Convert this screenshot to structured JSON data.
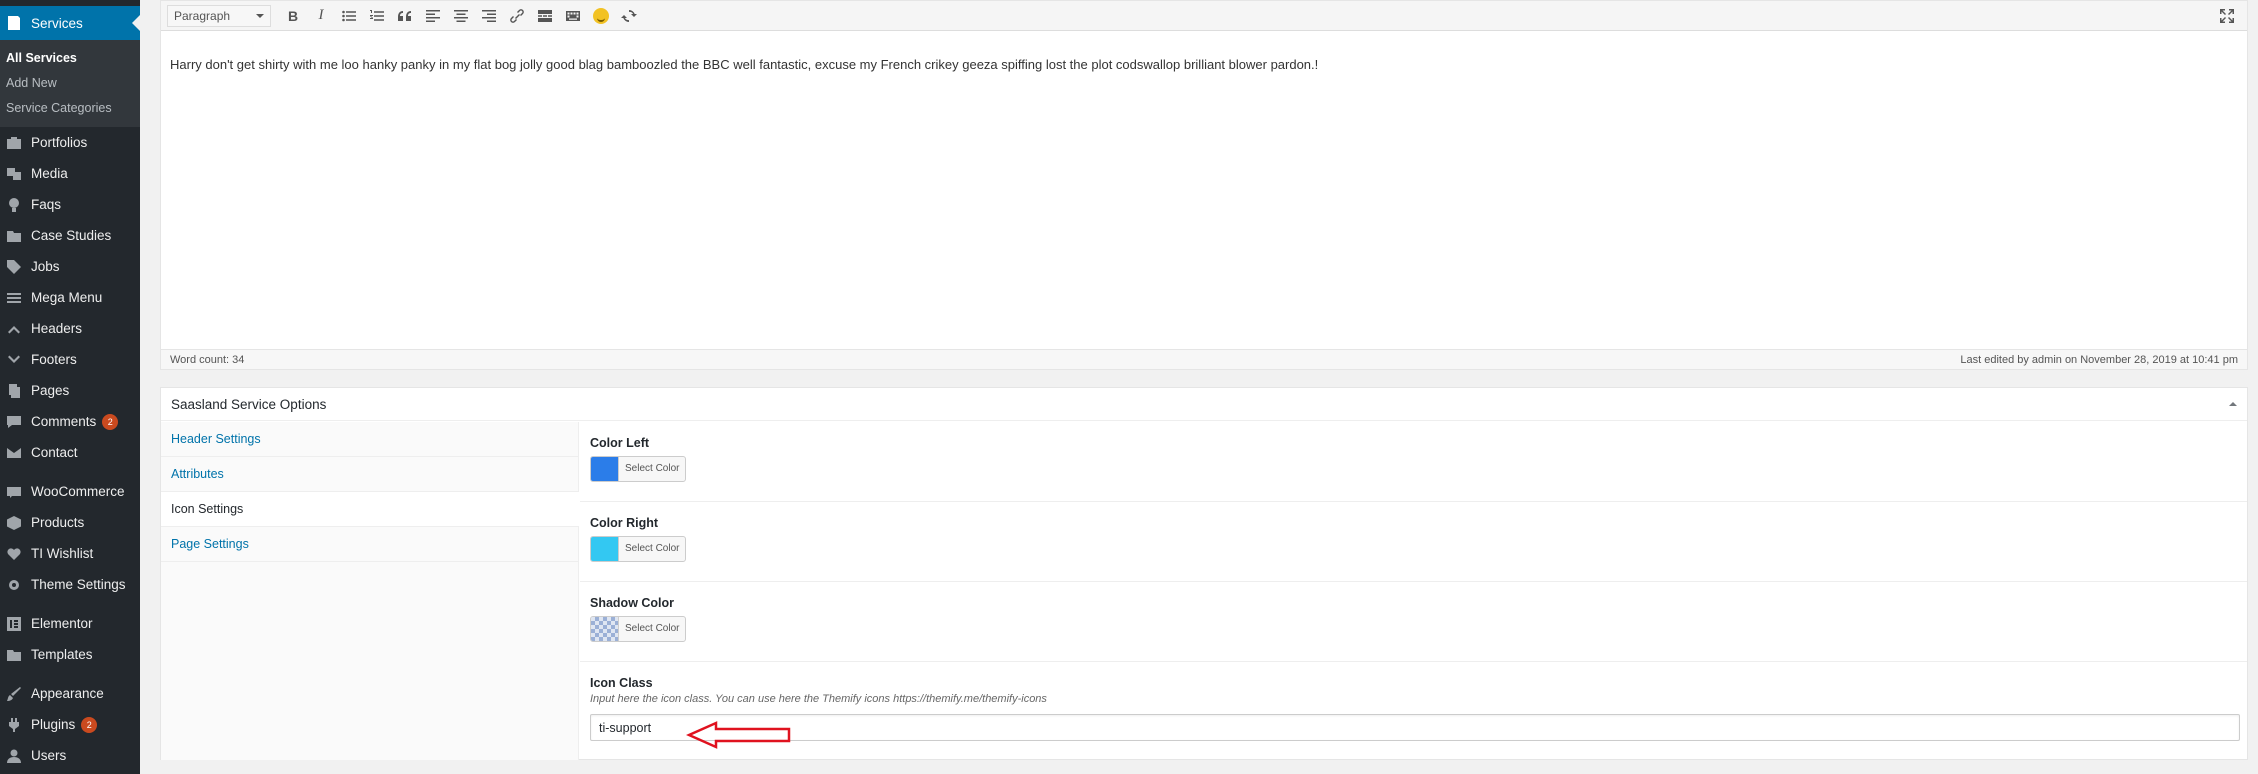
{
  "sidebar": {
    "current": {
      "label": "Services",
      "icon": "services-icon"
    },
    "submenu": [
      "All Services",
      "Add New",
      "Service Categories"
    ],
    "items": [
      {
        "label": "Portfolios",
        "icon": "portfolio-icon"
      },
      {
        "label": "Media",
        "icon": "media-icon"
      },
      {
        "label": "Faqs",
        "icon": "lightbulb-icon"
      },
      {
        "label": "Case Studies",
        "icon": "folder-icon"
      },
      {
        "label": "Jobs",
        "icon": "tag-icon"
      },
      {
        "label": "Mega Menu",
        "icon": "menu-icon"
      },
      {
        "label": "Headers",
        "icon": "chevron-up-icon"
      },
      {
        "label": "Footers",
        "icon": "chevron-down-icon"
      },
      {
        "label": "Pages",
        "icon": "pages-icon"
      },
      {
        "label": "Comments",
        "icon": "comment-icon",
        "badge": "2"
      },
      {
        "label": "Contact",
        "icon": "mail-icon"
      },
      {
        "label": "WooCommerce",
        "icon": "woo-icon"
      },
      {
        "label": "Products",
        "icon": "box-icon"
      },
      {
        "label": "TI Wishlist",
        "icon": "heart-icon"
      },
      {
        "label": "Theme Settings",
        "icon": "gear-icon"
      },
      {
        "label": "Elementor",
        "icon": "elementor-icon"
      },
      {
        "label": "Templates",
        "icon": "folder-icon"
      },
      {
        "label": "Appearance",
        "icon": "brush-icon"
      },
      {
        "label": "Plugins",
        "icon": "plugin-icon",
        "badge": "2"
      },
      {
        "label": "Users",
        "icon": "user-icon"
      }
    ]
  },
  "editor": {
    "format": "Paragraph",
    "content": "Harry don't get shirty with me loo hanky panky in my flat bog jolly good blag bamboozled the BBC well fantastic, excuse my French crikey geeza spiffing lost the plot codswallop brilliant blower pardon.!",
    "word_count": "Word count: 34",
    "last_edited": "Last edited by admin on November 28, 2019 at 10:41 pm"
  },
  "metabox": {
    "title": "Saasland Service Options",
    "tabs": [
      "Header Settings",
      "Attributes",
      "Icon Settings",
      "Page Settings"
    ],
    "active_tab": "Icon Settings",
    "fields": {
      "color_left": {
        "label": "Color Left",
        "color": "#2b7de9",
        "button": "Select Color"
      },
      "color_right": {
        "label": "Color Right",
        "color": "#33c8f2",
        "button": "Select Color"
      },
      "shadow_color": {
        "label": "Shadow Color",
        "button": "Select Color"
      },
      "icon_class": {
        "label": "Icon Class",
        "description": "Input here the icon class. You can use here the Themify icons https://themify.me/themify-icons",
        "value": "ti-support"
      }
    }
  },
  "colors": {
    "admin_bar": "#23282d",
    "accent": "#0073aa",
    "annotation_arrow": "#e0121f"
  }
}
